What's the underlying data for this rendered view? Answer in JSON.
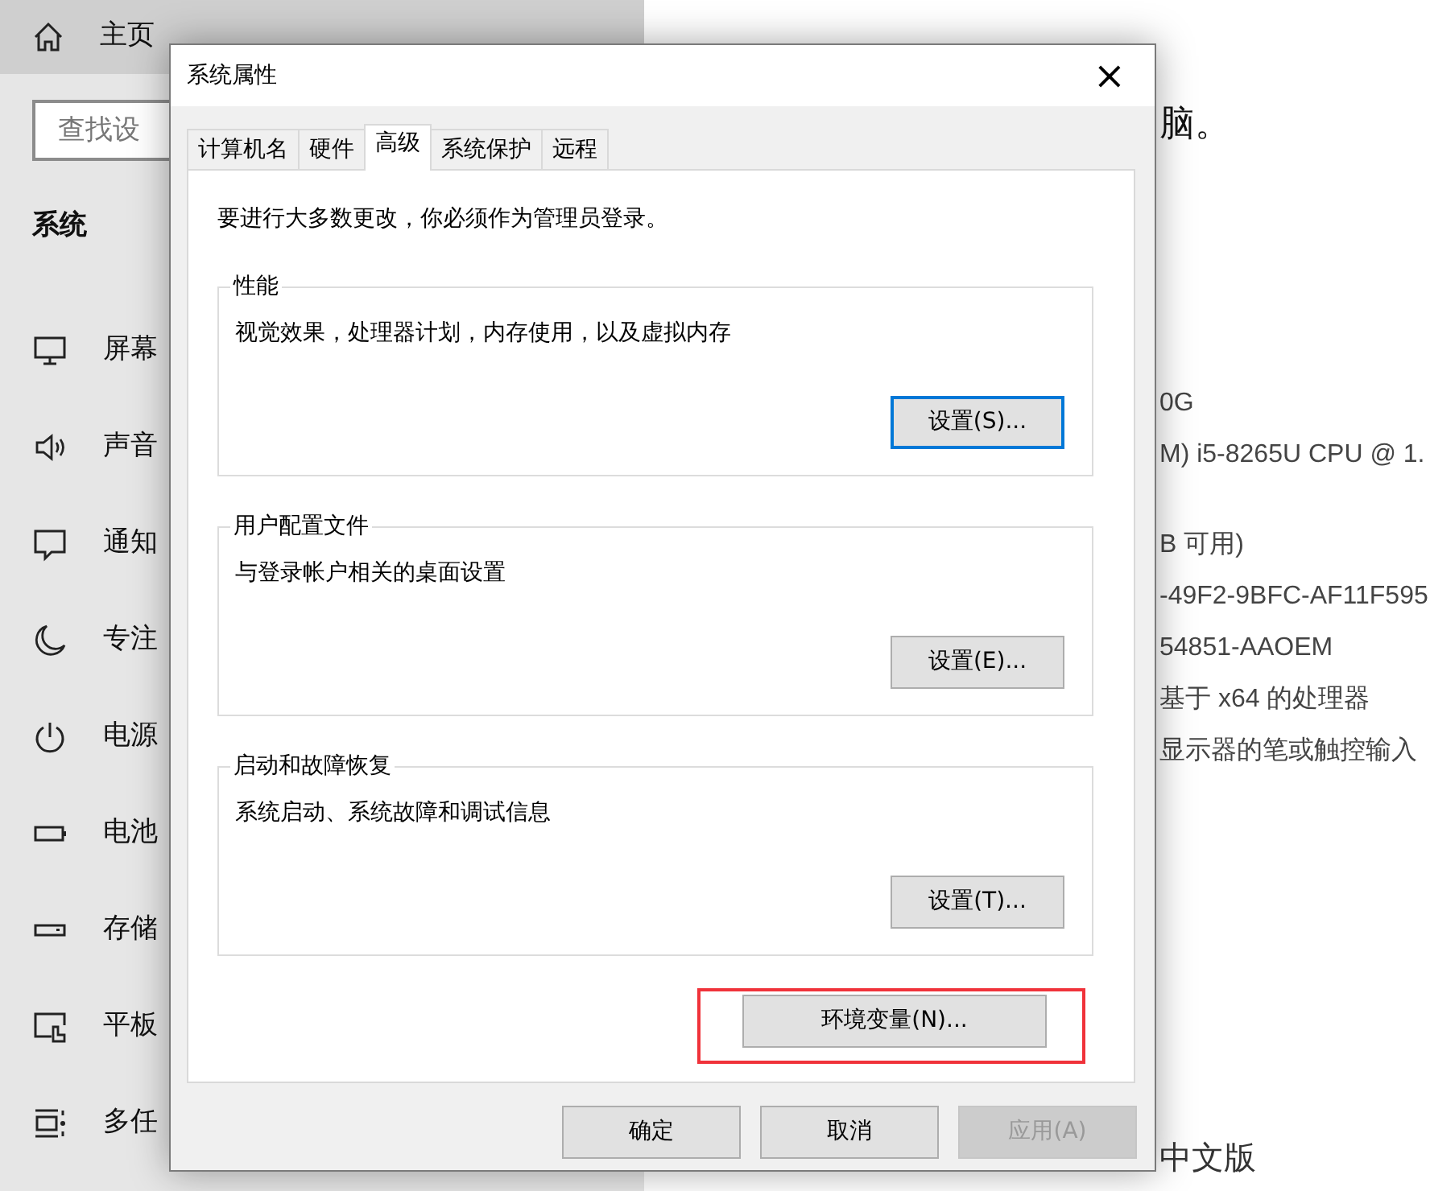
{
  "settings": {
    "home": "主页",
    "search": {
      "placeholder": "查找设"
    },
    "section": "系统",
    "nav": [
      {
        "label": "屏幕"
      },
      {
        "label": "声音"
      },
      {
        "label": "通知"
      },
      {
        "label": "专注"
      },
      {
        "label": "电源"
      },
      {
        "label": "电池"
      },
      {
        "label": "存储"
      },
      {
        "label": "平板"
      },
      {
        "label": "多任"
      }
    ],
    "subheading": "脑。",
    "specs": [
      "0G",
      "M) i5-8265U CPU @ 1.",
      "B 可用)",
      "-49F2-9BFC-AF11F595",
      "54851-AAOEM",
      "基于 x64 的处理器",
      "显示器的笔或触控输入"
    ],
    "edition": "中文版"
  },
  "dialog": {
    "title": "系统属性",
    "close": "×",
    "tabs": [
      {
        "label": "计算机名",
        "selected": false
      },
      {
        "label": "硬件",
        "selected": false
      },
      {
        "label": "高级",
        "selected": true
      },
      {
        "label": "系统保护",
        "selected": false
      },
      {
        "label": "远程",
        "selected": false
      }
    ],
    "notice": "要进行大多数更改，你必须作为管理员登录。",
    "groups": [
      {
        "title": "性能",
        "description": "视觉效果，处理器计划，内存使用，以及虚拟内存",
        "button": {
          "label": "设置(S)...",
          "focused": true
        }
      },
      {
        "title": "用户配置文件",
        "description": "与登录帐户相关的桌面设置",
        "button": {
          "label": "设置(E)...",
          "focused": false
        }
      },
      {
        "title": "启动和故障恢复",
        "description": "系统启动、系统故障和调试信息",
        "button": {
          "label": "设置(T)...",
          "focused": false
        }
      }
    ],
    "env_button": {
      "label": "环境变量(N)...",
      "highlighted": true
    },
    "buttons": [
      {
        "label": "确定",
        "disabled": false
      },
      {
        "label": "取消",
        "disabled": false
      },
      {
        "label": "应用(A)",
        "disabled": true
      }
    ]
  }
}
